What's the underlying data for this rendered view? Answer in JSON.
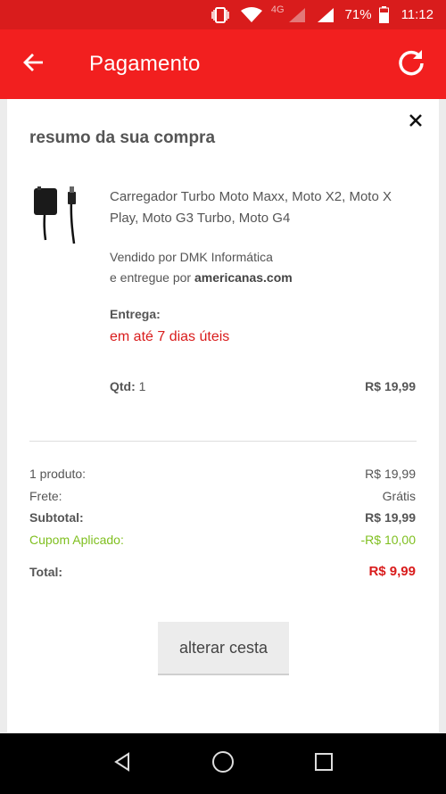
{
  "status_bar": {
    "network": "4G",
    "battery": "71%",
    "time": "11:12"
  },
  "app_bar": {
    "title": "Pagamento"
  },
  "summary": {
    "title": "resumo da sua compra",
    "product": {
      "name": "Carregador Turbo Moto Maxx, Moto X2, Moto X Play, Moto G3 Turbo, Moto G4",
      "sold_by": "Vendido por DMK Informática",
      "delivered_by_prefix": "e entregue por",
      "delivered_by_store": "americanas.com",
      "delivery_label": "Entrega:",
      "delivery_value": "em até 7 dias úteis",
      "qty_label": "Qtd:",
      "qty_value": "1",
      "price": "R$ 19,99"
    },
    "totals": [
      {
        "label": "1 produto:",
        "value": "R$ 19,99",
        "style": ""
      },
      {
        "label": "Frete:",
        "value": "Grátis",
        "style": ""
      },
      {
        "label": "Subtotal:",
        "value": "R$ 19,99",
        "style": "bold"
      },
      {
        "label": "Cupom Aplicado:",
        "value": "-R$ 10,00",
        "style": "green"
      },
      {
        "label": "Total:",
        "value": "R$ 9,99",
        "style": "total"
      }
    ],
    "change_cart_button": "alterar cesta"
  },
  "colors": {
    "status_bar": "#d91c1c",
    "app_bar": "#f21f1f",
    "accent_red": "#d91c1c",
    "coupon_green": "#7fbf1f"
  },
  "icons": {
    "back": "arrow-left-icon",
    "refresh": "refresh-icon",
    "close": "close-icon",
    "nav_back": "triangle-back-icon",
    "nav_home": "circle-home-icon",
    "nav_recents": "square-recents-icon"
  }
}
